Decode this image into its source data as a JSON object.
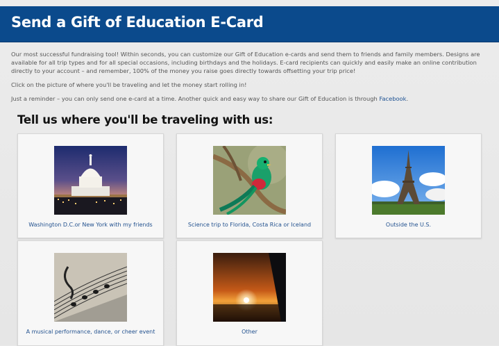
{
  "banner": {
    "title": "Send a Gift of Education E-Card"
  },
  "intro": {
    "p1": "Our most successful fundraising tool!  Within seconds, you can customize our Gift of Education e-cards and send them to friends and family members. Designs are available for all trip types and for all special occasions, including birthdays and the holidays. E-card recipients can quickly and easily make an online contribution directly to your account – and remember, 100% of the money you raise goes directly towards offsetting your trip price!",
    "p2": "Click on the picture of where you'll be traveling and let the money start rolling in!",
    "p3_prefix": "Just a reminder – you can only send one e-card at a time. Another quick and easy way to share our Gift of Education is through ",
    "p3_link": "Facebook",
    "p3_suffix": "."
  },
  "section": {
    "title": "Tell us where you'll be traveling with us:"
  },
  "cards": [
    {
      "caption": "Washington D.C.or New York with my friends",
      "image": "capitol-photo"
    },
    {
      "caption": "Science trip to Florida, Costa Rica or Iceland",
      "image": "quetzal-bird-photo"
    },
    {
      "caption": "Outside the U.S.",
      "image": "eiffel-tower-photo"
    },
    {
      "caption": "A musical performance, dance, or cheer event",
      "image": "sheet-music-photo"
    },
    {
      "caption": "Other",
      "image": "sunset-wing-photo"
    }
  ]
}
